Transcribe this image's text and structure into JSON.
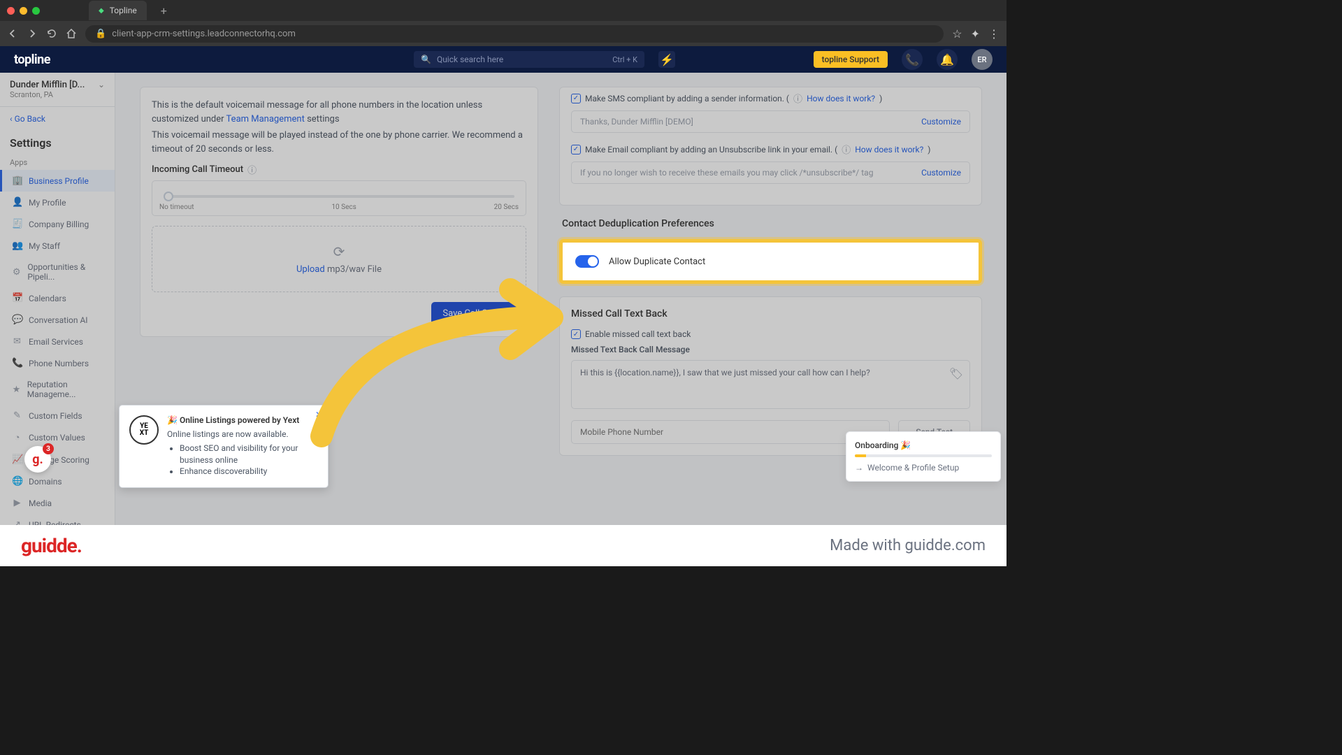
{
  "browser": {
    "tab_title": "Topline",
    "url": "client-app-crm-settings.leadconnectorhq.com"
  },
  "header": {
    "logo": "topline",
    "search_placeholder": "Quick search here",
    "search_shortcut": "Ctrl + K",
    "support_label": "topline Support",
    "avatar_initials": "ER"
  },
  "sidebar": {
    "location_name": "Dunder Mifflin [D...",
    "location_sub": "Scranton, PA",
    "go_back": "‹ Go Back",
    "settings_title": "Settings",
    "apps_label": "Apps",
    "items": [
      {
        "label": "Business Profile",
        "icon": "🏢",
        "active": true
      },
      {
        "label": "My Profile",
        "icon": "👤"
      },
      {
        "label": "Company Billing",
        "icon": "🧾"
      },
      {
        "label": "My Staff",
        "icon": "👥"
      },
      {
        "label": "Opportunities & Pipeli...",
        "icon": "⚙"
      },
      {
        "label": "Calendars",
        "icon": "📅"
      },
      {
        "label": "Conversation AI",
        "icon": "💬"
      },
      {
        "label": "Email Services",
        "icon": "✉"
      },
      {
        "label": "Phone Numbers",
        "icon": "📞"
      },
      {
        "label": "Reputation Manageme...",
        "icon": "★"
      },
      {
        "label": "Custom Fields",
        "icon": "✎"
      },
      {
        "label": "Custom Values",
        "icon": "◔"
      },
      {
        "label": "Manage Scoring",
        "icon": "📈"
      },
      {
        "label": "Domains",
        "icon": "🌐"
      },
      {
        "label": "Media",
        "icon": "▶"
      },
      {
        "label": "URL Redirects",
        "icon": "↗"
      }
    ]
  },
  "voicemail": {
    "desc1": "This is the default voicemail message for all phone numbers in the location unless customized under",
    "team_mgmt": "Team Management",
    "desc1_suffix": " settings",
    "desc2": "This voicemail message will be played instead of the one by phone carrier. We recommend a timeout of 20 seconds or less.",
    "timeout_label": "Incoming Call Timeout",
    "slider": {
      "min": "No timeout",
      "mid": "10 Secs",
      "max": "20 Secs"
    },
    "upload_action": "Upload",
    "upload_suffix": " mp3/wav File",
    "save_btn": "Save Call Settings"
  },
  "compliance": {
    "sms_label": "Make SMS compliant by adding a sender information.  (",
    "how_link": "How does it work?",
    "sms_placeholder": "Thanks, Dunder Mifflin [DEMO]",
    "email_label": "Make Email compliant by adding an Unsubscribe link in your email.  (",
    "email_placeholder": "If you no longer wish to receive these emails you may click /*unsubscribe*/ tag",
    "customize": "Customize"
  },
  "dedup": {
    "title": "Contact Deduplication Preferences",
    "toggle_label": "Allow Duplicate Contact"
  },
  "missed": {
    "title": "Missed Call Text Back",
    "enable_label": "Enable missed call text back",
    "message_label": "Missed Text Back Call Message",
    "message_value": "Hi this is {{location.name}}, I saw that we just missed your call how can I help?",
    "phone_placeholder": "Mobile Phone Number",
    "send_test": "Send Test"
  },
  "yext": {
    "title": "Online Listings powered by Yext",
    "line1": "Online listings are now available.",
    "bullet1": "Boost SEO and visibility for your business online",
    "bullet2": "Enhance discoverability"
  },
  "onboarding": {
    "title": "Onboarding 🎉",
    "step": "Welcome & Profile Setup"
  },
  "footer": {
    "logo": "guidde.",
    "made": "Made with guidde.com"
  },
  "badge_count": "3"
}
